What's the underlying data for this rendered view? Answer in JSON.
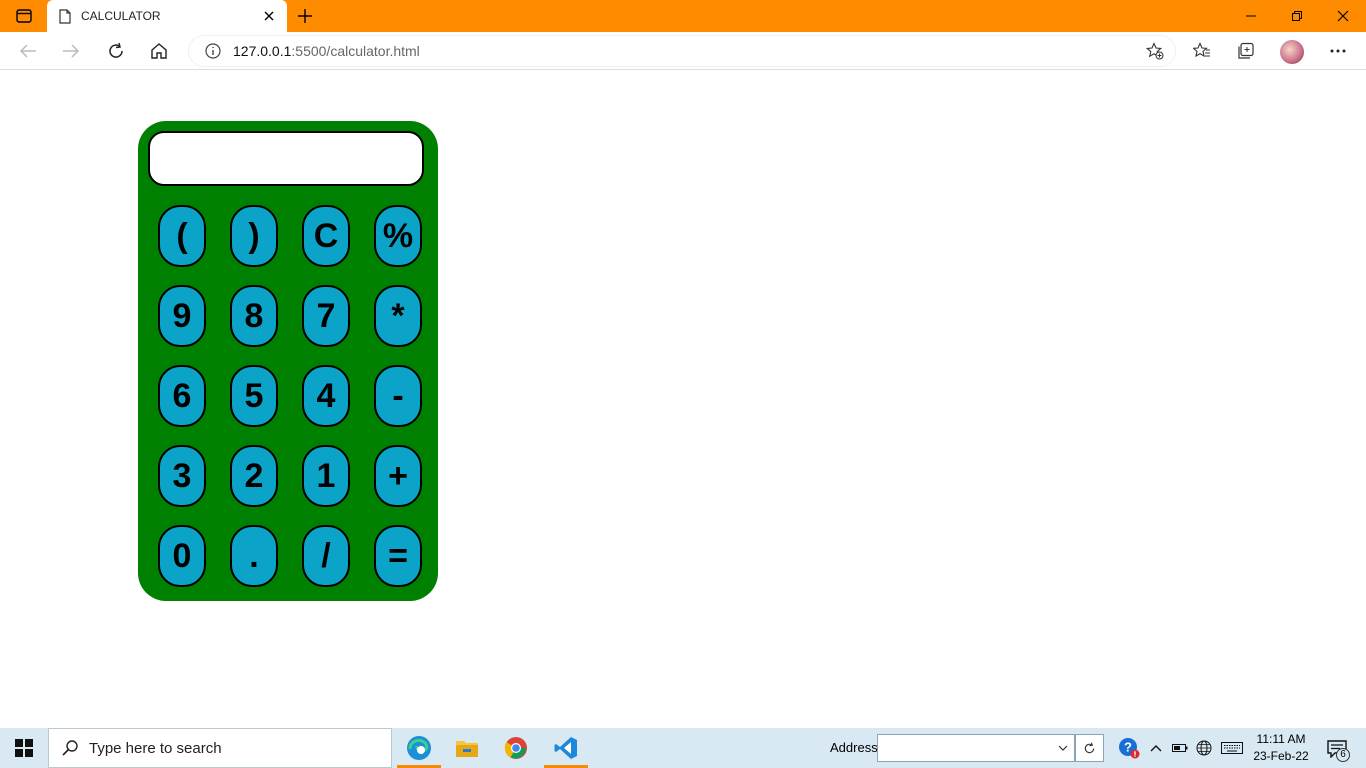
{
  "browser": {
    "tab_title": "CALCULATOR",
    "address_host": "127.0.0.1",
    "address_rest": ":5500/calculator.html",
    "accent_color": "#ff8c00"
  },
  "calculator": {
    "display_value": "",
    "body_color": "#008000",
    "key_color": "#0ba3c7",
    "keys": [
      [
        "(",
        ")",
        "C",
        "%"
      ],
      [
        "9",
        "8",
        "7",
        "*"
      ],
      [
        "6",
        "5",
        "4",
        "-"
      ],
      [
        "3",
        "2",
        "1",
        "+"
      ],
      [
        "0",
        ".",
        "/",
        "="
      ]
    ]
  },
  "taskbar": {
    "search_placeholder": "Type here to search",
    "address_label": "Address",
    "address_value": "",
    "time": "11:11 AM",
    "date": "23-Feb-22",
    "notification_count": "6",
    "apps": [
      "edge-icon",
      "file-explorer-icon",
      "chrome-icon",
      "vscode-icon"
    ]
  }
}
